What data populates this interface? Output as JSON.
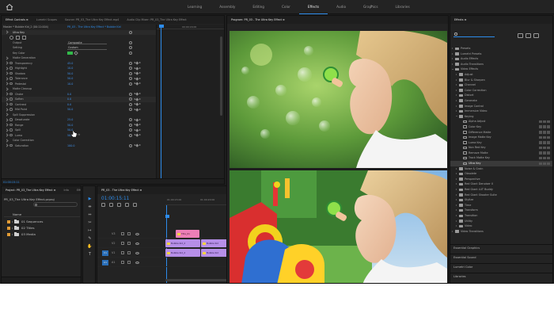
{
  "header": {
    "workspaces": [
      "Learning",
      "Assembly",
      "Editing",
      "Color",
      "Effects",
      "Audio",
      "Graphics",
      "Libraries"
    ],
    "active_workspace": "Effects",
    "more": "»"
  },
  "effect_controls": {
    "tabs": [
      "Effect Controls ≡",
      "Lumetri Scopes",
      "Source: PR_03_The Ultra Key Effect.mp4",
      "Audio Clip Mixer: PR_03_The Ultra Key Effect"
    ],
    "source_label": "Master * Bubble Kid_2 (00:11:004)",
    "sequence_label": "PR_03 - The Ultra Key Effect * Bubble Kid",
    "timecode": "00:00:16:00",
    "effect_name": "Ultra Key",
    "rows": [
      {
        "label": "Output",
        "value": "Composite",
        "type": "select"
      },
      {
        "label": "Setting",
        "value": "Custom",
        "type": "select"
      },
      {
        "label": "Key Color",
        "type": "color"
      },
      {
        "label": "Matte Generation",
        "type": "group"
      },
      {
        "label": "Transparency",
        "value": "45.0",
        "type": "prop"
      },
      {
        "label": "Highlight",
        "value": "10.0",
        "type": "prop"
      },
      {
        "label": "Shadow",
        "value": "50.0",
        "type": "prop"
      },
      {
        "label": "Tolerance",
        "value": "50.0",
        "type": "prop"
      },
      {
        "label": "Pedestal",
        "value": "10.0",
        "type": "prop"
      },
      {
        "label": "Matte Cleanup",
        "type": "group"
      },
      {
        "label": "Choke",
        "value": "0.0",
        "type": "prop"
      },
      {
        "label": "Soften",
        "value": "0.0",
        "type": "prop"
      },
      {
        "label": "Contrast",
        "value": "0.0",
        "type": "prop"
      },
      {
        "label": "Mid Point",
        "value": "50.0",
        "type": "prop"
      },
      {
        "label": "Spill Suppression",
        "type": "group"
      },
      {
        "label": "Desaturate",
        "value": "25.0",
        "type": "prop"
      },
      {
        "label": "Range",
        "value": "50.0",
        "type": "prop"
      },
      {
        "label": "Spill",
        "value": "50.0",
        "type": "prop"
      },
      {
        "label": "Luma",
        "value": "50.0",
        "type": "prop"
      },
      {
        "label": "Color Correction",
        "type": "group"
      },
      {
        "label": "Saturation",
        "value": "100.0",
        "type": "prop"
      }
    ],
    "footer_time": "01:00:15:11",
    "key_color_hex": "#32b94a"
  },
  "project": {
    "tabs": [
      "Project: PR_03_The Ultra Key Effect ≡",
      "Info",
      "Effects"
    ],
    "title": "PR_03_The Ultra Key Effect.prproj",
    "column": "Name",
    "items": [
      {
        "label": "01 Sequences",
        "color": "#e19b35"
      },
      {
        "label": "02 Titles",
        "color": "#e19b35"
      },
      {
        "label": "03 Media",
        "color": "#e19b35"
      }
    ]
  },
  "tools": [
    "▶",
    "⇹",
    "⇔",
    "✂",
    "↦",
    "✎",
    "✋",
    "T"
  ],
  "timeline": {
    "tabs": [
      "PR_03 - The Ultra Key Effect ≡"
    ],
    "timecode": "01:00:15:11",
    "ruler": [
      "01:00:15:00",
      "01:00:20:00"
    ],
    "tracks": [
      {
        "label": "V3",
        "target": ""
      },
      {
        "label": "V2",
        "target": ""
      },
      {
        "label": "V1",
        "target": "V1"
      },
      {
        "label": "A1",
        "target": "A1"
      }
    ],
    "clips": [
      {
        "label": "Title_01",
        "kind": "pink"
      },
      {
        "label": "Bubble Kid_2",
        "kind": "violet"
      },
      {
        "label": "Bubble Kid",
        "kind": "violet"
      },
      {
        "label": "Bubble Kid_2",
        "kind": "violet"
      },
      {
        "label": "Bubble Kid",
        "kind": "violet"
      }
    ]
  },
  "program_monitor": {
    "tabs": [
      "Program: PR_03 - The Ultra Key Effect ≡"
    ]
  },
  "effects_panel": {
    "tabs": [
      "Effects ≡"
    ],
    "items": [
      {
        "label": "Presets",
        "level": 1,
        "icon": "folder",
        "open": false
      },
      {
        "label": "Lumetri Presets",
        "level": 1,
        "icon": "folder",
        "open": false
      },
      {
        "label": "Audio Effects",
        "level": 1,
        "icon": "folder",
        "open": false
      },
      {
        "label": "Audio Transitions",
        "level": 1,
        "icon": "folder",
        "open": false
      },
      {
        "label": "Video Effects",
        "level": 1,
        "icon": "folder",
        "open": true
      },
      {
        "label": "Adjust",
        "level": 2,
        "icon": "folder",
        "open": false
      },
      {
        "label": "Blur & Sharpen",
        "level": 2,
        "icon": "folder",
        "open": false
      },
      {
        "label": "Channel",
        "level": 2,
        "icon": "folder",
        "open": false
      },
      {
        "label": "Color Correction",
        "level": 2,
        "icon": "folder",
        "open": false
      },
      {
        "label": "Distort",
        "level": 2,
        "icon": "folder",
        "open": false
      },
      {
        "label": "Generate",
        "level": 2,
        "icon": "folder",
        "open": false
      },
      {
        "label": "Image Control",
        "level": 2,
        "icon": "folder",
        "open": false
      },
      {
        "label": "Immersive Video",
        "level": 2,
        "icon": "folder",
        "open": false
      },
      {
        "label": "Keying",
        "level": 2,
        "icon": "folder",
        "open": true
      },
      {
        "label": "Alpha Adjust",
        "level": 3,
        "icon": "effect"
      },
      {
        "label": "Color Key",
        "level": 3,
        "icon": "effect"
      },
      {
        "label": "Difference Matte",
        "level": 3,
        "icon": "effect"
      },
      {
        "label": "Image Matte Key",
        "level": 3,
        "icon": "effect"
      },
      {
        "label": "Luma Key",
        "level": 3,
        "icon": "effect"
      },
      {
        "label": "Non Red Key",
        "level": 3,
        "icon": "effect"
      },
      {
        "label": "Remove Matte",
        "level": 3,
        "icon": "effect"
      },
      {
        "label": "Track Matte Key",
        "level": 3,
        "icon": "effect"
      },
      {
        "label": "Ultra Key",
        "level": 3,
        "icon": "effect",
        "selected": true
      },
      {
        "label": "Noise & Grain",
        "level": 2,
        "icon": "folder",
        "open": false
      },
      {
        "label": "Obsolete",
        "level": 2,
        "icon": "folder",
        "open": false
      },
      {
        "label": "Perspective",
        "level": 2,
        "icon": "folder",
        "open": false
      },
      {
        "label": "Red Giant Denoiser II",
        "level": 2,
        "icon": "folder",
        "open": false
      },
      {
        "label": "Red Giant LUT Buddy",
        "level": 2,
        "icon": "folder",
        "open": false
      },
      {
        "label": "Red Giant Shooter Suite",
        "level": 2,
        "icon": "folder",
        "open": false
      },
      {
        "label": "Stylize",
        "level": 2,
        "icon": "folder",
        "open": false
      },
      {
        "label": "Time",
        "level": 2,
        "icon": "folder",
        "open": false
      },
      {
        "label": "Transform",
        "level": 2,
        "icon": "folder",
        "open": false
      },
      {
        "label": "Transition",
        "level": 2,
        "icon": "folder",
        "open": false
      },
      {
        "label": "Utility",
        "level": 2,
        "icon": "folder",
        "open": false
      },
      {
        "label": "Video",
        "level": 2,
        "icon": "folder",
        "open": false
      },
      {
        "label": "Video Transitions",
        "level": 1,
        "icon": "folder",
        "open": false
      }
    ],
    "sections": [
      "Essential Graphics",
      "Essential Sound",
      "Lumetri Color",
      "Libraries"
    ]
  },
  "colors": {
    "accent": "#2d8ceb",
    "violet_clip": "#b68fe8",
    "pink_clip": "#ec7fb7",
    "folder_label": "#e19b35"
  }
}
